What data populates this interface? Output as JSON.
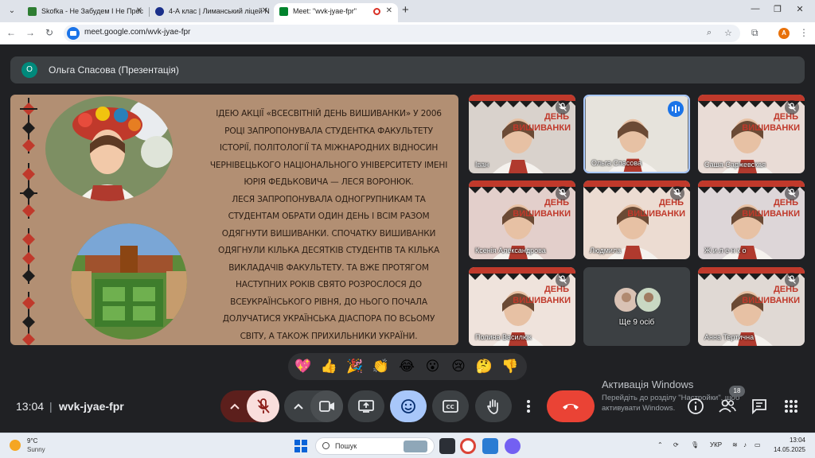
{
  "browser": {
    "tabs": [
      {
        "title": "Skofka - Не Забудем І Не Прос",
        "favicon_color": "#2e7d32",
        "active": false
      },
      {
        "title": "4-А клас | Лиманський ліцей N",
        "favicon_color": "#1a2f8a",
        "active": false
      },
      {
        "title": "Meet: \"wvk-jyae-fpr\"",
        "favicon_color": "#00832d",
        "active": true
      }
    ],
    "url": "meet.google.com/wvk-jyae-fpr",
    "profile_initial": "A"
  },
  "meet": {
    "presenter": {
      "initial": "О",
      "label": "Ольга Спасова (Презентація)"
    },
    "slide_text": [
      "ІДЕЮ АКЦІЇ «ВСЕСВІТНІЙ ДЕНЬ ВИШИВАНКИ» У 2006",
      "РОЦІ ЗАПРОПОНУВАЛА СТУДЕНТКА ФАКУЛЬТЕТУ",
      "ІСТОРІЇ, ПОЛІТОЛОГІЇ ТА МІЖНАРОДНИХ ВІДНОСИН",
      "ЧЕРНІВЕЦЬКОГО НАЦІОНАЛЬНОГО УНІВЕРСИТЕТУ ІМЕНІ",
      "ЮРІЯ ФЕДЬКОВИЧА — ЛЕСЯ ВОРОНЮК.",
      "ЛЕСЯ ЗАПРОПОНУВАЛА ОДНОГРУПНИКАМ ТА",
      "СТУДЕНТАМ ОБРАТИ ОДИН ДЕНЬ І ВСІМ РАЗОМ",
      "ОДЯГНУТИ ВИШИВАНКИ. СПОЧАТКУ ВИШИВАНКИ",
      "ОДЯГНУЛИ КІЛЬКА ДЕСЯТКІВ СТУДЕНТІВ ТА КІЛЬКА",
      "ВИКЛАДАЧІВ ФАКУЛЬТЕТУ. ТА ВЖЕ ПРОТЯГОМ",
      "НАСТУПНИХ РОКІВ СВЯТО РОЗРОСЛОСЯ ДО",
      "ВСЕУКРАЇНСЬКОГО РІВНЯ, ДО НЬОГО ПОЧАЛА",
      "ДОЛУЧАТИСЯ УКРАЇНСЬКА ДІАСПОРА ПО ВСЬОМУ",
      "СВІТУ, А ТАКОЖ ПРИХИЛЬНИКИ УКРАЇНИ."
    ],
    "participants": [
      {
        "name": "Іван",
        "muted": true,
        "speaking": false,
        "bg": "#d9d2cc"
      },
      {
        "name": "Ольга Спасова",
        "muted": false,
        "speaking": true,
        "bg": "#e6e3dc"
      },
      {
        "name": "Саша Саржевская",
        "muted": true,
        "speaking": false,
        "bg": "#e9dcd6"
      },
      {
        "name": "Ксенія Александрова",
        "muted": true,
        "speaking": false,
        "bg": "#e3cfcb"
      },
      {
        "name": "Людмила",
        "muted": true,
        "speaking": false,
        "bg": "#ecdcd2"
      },
      {
        "name": "Ж и л е н к о",
        "muted": true,
        "speaking": false,
        "bg": "#ddd6d8"
      },
      {
        "name": "Полина Василюк",
        "muted": true,
        "speaking": false,
        "bg": "#efe3dc"
      },
      {
        "name": "Анна Тертична",
        "muted": true,
        "speaking": false,
        "bg": "#e0d9d4"
      }
    ],
    "banner_words": [
      "ДЕНЬ",
      "ВИШИВАНКИ"
    ],
    "more_people_label": "Ще 9 осіб",
    "reactions": [
      "💖",
      "👍",
      "🎉",
      "👏",
      "😂",
      "😮",
      "😢",
      "🤔",
      "👎"
    ],
    "clock": "13:04",
    "clock_separator": "|",
    "meeting_code": "wvk-jyae-fpr",
    "people_count": "18",
    "activation": {
      "title": "Активація Windows",
      "subtitle": "Перейдіть до розділу \"Настройки\", щоб активувати Windows."
    }
  },
  "taskbar": {
    "weather_temp": "9°C",
    "weather_cond": "Sunny",
    "search_placeholder": "Пошук",
    "lang": "УКР",
    "time": "13:04",
    "date": "14.05.2025"
  },
  "colors": {
    "meet_bg": "#202124",
    "tile_bg": "#3c4043",
    "end_call": "#ea4335",
    "active_blue": "#a8c7fa",
    "mic_off_bg": "#f9dedc"
  }
}
